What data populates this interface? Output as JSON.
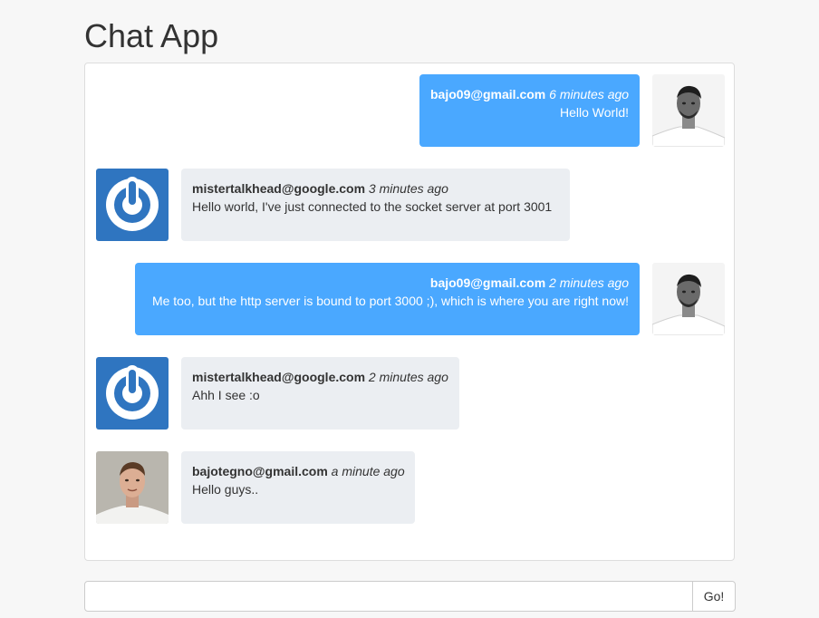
{
  "app": {
    "title": "Chat App"
  },
  "messages": [
    {
      "author": "bajo09@gmail.com",
      "time": "6 minutes ago",
      "text": "Hello World!",
      "mine": true,
      "avatar": "bw-portrait-avatar"
    },
    {
      "author": "mistertalkhead@google.com",
      "time": "3 minutes ago",
      "text": "Hello world, I've just connected to the socket server at port 3001",
      "mine": false,
      "avatar": "power-logo-avatar"
    },
    {
      "author": "bajo09@gmail.com",
      "time": "2 minutes ago",
      "text": "Me too, but the http server is bound to port 3000 ;), which is where you are right now!",
      "mine": true,
      "avatar": "bw-portrait-avatar"
    },
    {
      "author": "mistertalkhead@google.com",
      "time": "2 minutes ago",
      "text": "Ahh I see :o",
      "mine": false,
      "avatar": "power-logo-avatar"
    },
    {
      "author": "bajotegno@gmail.com",
      "time": "a minute ago",
      "text": "Hello guys..",
      "mine": false,
      "avatar": "color-portrait-avatar"
    }
  ],
  "composer": {
    "value": "",
    "placeholder": "",
    "button_label": "Go!"
  },
  "colors": {
    "mine_bubble": "#4aa8ff",
    "theirs_bubble": "#ebeef2",
    "logo_blue": "#2f75c0"
  }
}
